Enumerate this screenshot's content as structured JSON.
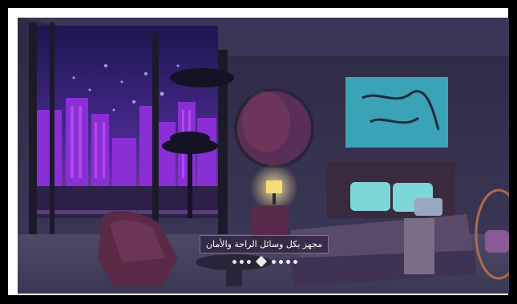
{
  "slider": {
    "caption": "مجهز بكل وسائل الراحة والأمان",
    "total_slides": 8,
    "active_index": 3
  },
  "colors": {
    "wall": "#3a3553",
    "sky": "#2a1e63",
    "neon": "#b24cff",
    "floor": "#4a4860",
    "pillow": "#7fd6d8"
  },
  "icons": [
    "pagination-dot-icon",
    "pagination-active-diamond-icon"
  ]
}
